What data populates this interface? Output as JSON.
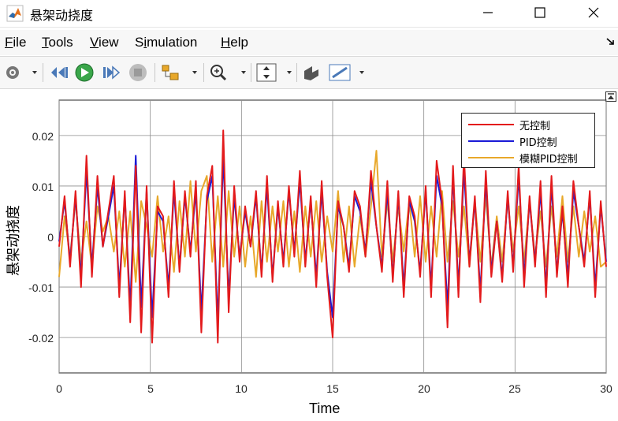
{
  "window": {
    "title": "悬架动挠度"
  },
  "menu": {
    "items": [
      {
        "accel": "F",
        "rest": "ile"
      },
      {
        "accel": "T",
        "rest": "ools"
      },
      {
        "accel": "V",
        "rest": "iew"
      },
      {
        "pre": "S",
        "accel": "i",
        "rest": "mulation"
      },
      {
        "accel": "H",
        "rest": "elp"
      }
    ]
  },
  "toolbar": {
    "icons": [
      "settings-icon",
      "step-back-icon",
      "run-icon",
      "step-forward-icon",
      "stop-icon",
      "signal-tracing-icon",
      "zoom-icon",
      "autoscale-icon",
      "highlight-icon",
      "measure-icon"
    ]
  },
  "colors": {
    "no_control": "#e31a1c",
    "pid": "#1a1ad6",
    "fuzzy_pid": "#e8a82a",
    "grid": "#262626"
  },
  "chart_data": {
    "type": "line",
    "title": "",
    "xlabel": "Time",
    "ylabel": "悬架动挠度",
    "xlim": [
      0,
      30
    ],
    "ylim": [
      -0.027,
      0.027
    ],
    "xticks": [
      0,
      5,
      10,
      15,
      20,
      25,
      30
    ],
    "yticks": [
      0.02,
      0.01,
      0,
      -0.01,
      -0.02
    ],
    "ytick_labels": [
      "0.02",
      "0.01",
      "0",
      "-0.01",
      "-0.02"
    ],
    "grid": true,
    "legend_position": "top-right",
    "series": [
      {
        "name": "无控制",
        "color": "#e31a1c",
        "x": [
          0,
          0.3,
          0.6,
          0.9,
          1.2,
          1.5,
          1.8,
          2.1,
          2.4,
          2.7,
          3.0,
          3.3,
          3.6,
          3.9,
          4.2,
          4.5,
          4.8,
          5.1,
          5.4,
          5.7,
          6.0,
          6.3,
          6.6,
          6.9,
          7.2,
          7.5,
          7.8,
          8.1,
          8.4,
          8.7,
          9.0,
          9.3,
          9.6,
          9.9,
          10.2,
          10.5,
          10.8,
          11.1,
          11.4,
          11.7,
          12.0,
          12.3,
          12.6,
          12.9,
          13.2,
          13.5,
          13.8,
          14.1,
          14.4,
          14.7,
          15.0,
          15.3,
          15.6,
          15.9,
          16.2,
          16.5,
          16.8,
          17.1,
          17.4,
          17.7,
          18.0,
          18.3,
          18.6,
          18.9,
          19.2,
          19.5,
          19.8,
          20.1,
          20.4,
          20.7,
          21.0,
          21.3,
          21.6,
          21.9,
          22.2,
          22.5,
          22.8,
          23.1,
          23.4,
          23.7,
          24.0,
          24.3,
          24.6,
          24.9,
          25.2,
          25.5,
          25.8,
          26.1,
          26.4,
          26.7,
          27.0,
          27.3,
          27.6,
          27.9,
          28.2,
          28.5,
          28.8,
          29.1,
          29.4,
          29.7,
          30.0
        ],
        "values": [
          -0.002,
          0.008,
          -0.006,
          0.009,
          -0.01,
          0.016,
          -0.008,
          0.012,
          -0.002,
          0.005,
          0.012,
          -0.012,
          0.009,
          -0.017,
          0.014,
          -0.019,
          0.01,
          -0.021,
          0.006,
          0.004,
          -0.012,
          0.011,
          -0.007,
          0.009,
          -0.004,
          0.011,
          -0.019,
          0.008,
          0.014,
          -0.021,
          0.021,
          -0.015,
          0.01,
          -0.005,
          0.006,
          -0.002,
          0.009,
          -0.008,
          0.012,
          -0.009,
          0.007,
          -0.006,
          0.01,
          -0.004,
          0.013,
          -0.006,
          0.008,
          -0.01,
          0.011,
          -0.008,
          -0.02,
          0.007,
          0.002,
          -0.007,
          0.009,
          0.006,
          -0.004,
          0.013,
          0.002,
          -0.007,
          0.011,
          -0.009,
          0.009,
          -0.012,
          0.008,
          0.004,
          -0.008,
          0.01,
          -0.012,
          0.015,
          0.007,
          -0.018,
          0.014,
          -0.012,
          0.016,
          -0.006,
          0.008,
          -0.013,
          0.013,
          -0.008,
          0.003,
          -0.009,
          0.009,
          -0.007,
          0.014,
          -0.01,
          0.008,
          -0.006,
          0.011,
          -0.012,
          0.012,
          -0.008,
          0.006,
          -0.01,
          0.011,
          0.002,
          -0.006,
          0.009,
          -0.012,
          0.007,
          -0.006
        ]
      },
      {
        "name": "PID控制",
        "color": "#1a1ad6",
        "x": [
          0,
          0.3,
          0.6,
          0.9,
          1.2,
          1.5,
          1.8,
          2.1,
          2.4,
          2.7,
          3.0,
          3.3,
          3.6,
          3.9,
          4.2,
          4.5,
          4.8,
          5.1,
          5.4,
          5.7,
          6.0,
          6.3,
          6.6,
          6.9,
          7.2,
          7.5,
          7.8,
          8.1,
          8.4,
          8.7,
          9.0,
          9.3,
          9.6,
          9.9,
          10.2,
          10.5,
          10.8,
          11.1,
          11.4,
          11.7,
          12.0,
          12.3,
          12.6,
          12.9,
          13.2,
          13.5,
          13.8,
          14.1,
          14.4,
          14.7,
          15.0,
          15.3,
          15.6,
          15.9,
          16.2,
          16.5,
          16.8,
          17.1,
          17.4,
          17.7,
          18.0,
          18.3,
          18.6,
          18.9,
          19.2,
          19.5,
          19.8,
          20.1,
          20.4,
          20.7,
          21.0,
          21.3,
          21.6,
          21.9,
          22.2,
          22.5,
          22.8,
          23.1,
          23.4,
          23.7,
          24.0,
          24.3,
          24.6,
          24.9,
          25.2,
          25.5,
          25.8,
          26.1,
          26.4,
          26.7,
          27.0,
          27.3,
          27.6,
          27.9,
          28.2,
          28.5,
          28.8,
          29.1,
          29.4,
          29.7,
          30.0
        ],
        "values": [
          -0.001,
          0.007,
          -0.005,
          0.008,
          -0.008,
          0.013,
          -0.006,
          0.01,
          -0.002,
          0.004,
          0.01,
          -0.01,
          0.008,
          -0.014,
          0.016,
          -0.014,
          0.009,
          -0.016,
          0.005,
          0.003,
          -0.01,
          0.009,
          -0.006,
          0.008,
          -0.003,
          0.009,
          -0.015,
          0.007,
          0.012,
          -0.017,
          0.016,
          -0.012,
          0.008,
          -0.004,
          0.005,
          -0.002,
          0.008,
          -0.007,
          0.01,
          -0.008,
          0.006,
          -0.005,
          0.009,
          -0.003,
          0.011,
          -0.005,
          0.007,
          -0.008,
          0.009,
          -0.007,
          -0.016,
          0.006,
          0.002,
          -0.006,
          0.008,
          0.005,
          -0.003,
          0.011,
          0.002,
          -0.006,
          0.009,
          -0.008,
          0.008,
          -0.01,
          0.007,
          0.003,
          -0.007,
          0.009,
          -0.01,
          0.012,
          0.006,
          -0.014,
          0.012,
          -0.01,
          0.013,
          -0.005,
          0.007,
          -0.011,
          0.011,
          -0.007,
          0.003,
          -0.008,
          0.008,
          -0.006,
          0.012,
          -0.008,
          0.007,
          -0.005,
          0.009,
          -0.01,
          0.01,
          -0.007,
          0.005,
          -0.008,
          0.009,
          0.002,
          -0.005,
          0.008,
          -0.01,
          0.006,
          -0.005
        ]
      },
      {
        "name": "模糊PID控制",
        "color": "#e8a82a",
        "x": [
          0,
          0.3,
          0.6,
          0.9,
          1.2,
          1.5,
          1.8,
          2.1,
          2.4,
          2.7,
          3.0,
          3.3,
          3.6,
          3.9,
          4.2,
          4.5,
          4.8,
          5.1,
          5.4,
          5.7,
          6.0,
          6.3,
          6.6,
          6.9,
          7.2,
          7.5,
          7.8,
          8.1,
          8.4,
          8.7,
          9.0,
          9.3,
          9.6,
          9.9,
          10.2,
          10.5,
          10.8,
          11.1,
          11.4,
          11.7,
          12.0,
          12.3,
          12.6,
          12.9,
          13.2,
          13.5,
          13.8,
          14.1,
          14.4,
          14.7,
          15.0,
          15.3,
          15.6,
          15.9,
          16.2,
          16.5,
          16.8,
          17.1,
          17.4,
          17.7,
          18.0,
          18.3,
          18.6,
          18.9,
          19.2,
          19.5,
          19.8,
          20.1,
          20.4,
          20.7,
          21.0,
          21.3,
          21.6,
          21.9,
          22.2,
          22.5,
          22.8,
          23.1,
          23.4,
          23.7,
          24.0,
          24.3,
          24.6,
          24.9,
          25.2,
          25.5,
          25.8,
          26.1,
          26.4,
          26.7,
          27.0,
          27.3,
          27.6,
          27.9,
          28.2,
          28.5,
          28.8,
          29.1,
          29.4,
          29.7,
          30.0
        ],
        "values": [
          -0.008,
          0.004,
          -0.004,
          0.007,
          -0.005,
          0.003,
          -0.006,
          0.006,
          0.001,
          0.004,
          -0.003,
          0.005,
          -0.006,
          0.005,
          -0.009,
          0.007,
          0.002,
          -0.004,
          0.008,
          -0.003,
          0.004,
          -0.007,
          0.007,
          -0.004,
          0.011,
          -0.003,
          0.009,
          0.012,
          -0.005,
          0.008,
          -0.006,
          0.009,
          -0.004,
          0.006,
          -0.006,
          0.004,
          -0.008,
          0.007,
          -0.005,
          0.006,
          -0.003,
          0.007,
          -0.006,
          0.005,
          -0.007,
          0.006,
          -0.004,
          0.007,
          -0.005,
          0.004,
          -0.003,
          0.009,
          -0.005,
          0.006,
          -0.006,
          0.004,
          -0.004,
          0.006,
          0.017,
          -0.004,
          0.007,
          -0.005,
          0.006,
          -0.003,
          0.007,
          -0.004,
          0.008,
          -0.005,
          0.006,
          -0.004,
          0.009,
          -0.005,
          0.007,
          -0.004,
          0.006,
          -0.006,
          0.007,
          -0.005,
          0.008,
          -0.006,
          0.004,
          -0.005,
          0.007,
          -0.003,
          0.006,
          -0.005,
          0.007,
          -0.004,
          0.005,
          -0.006,
          0.006,
          -0.004,
          0.008,
          -0.005,
          0.006,
          -0.004,
          0.005,
          -0.003,
          0.004,
          -0.006,
          -0.005
        ]
      }
    ]
  }
}
